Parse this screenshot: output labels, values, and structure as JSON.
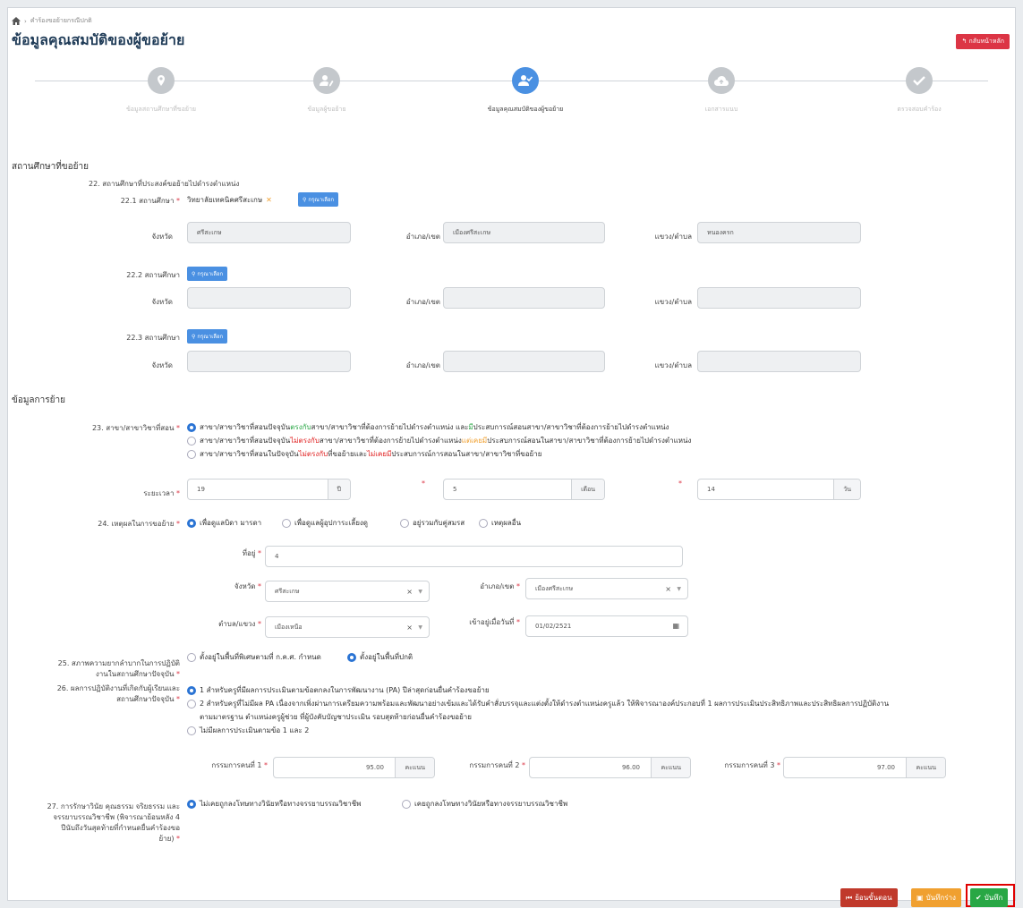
{
  "breadcrumb": {
    "home_icon": "home-icon",
    "path": "คำร้องขอย้ายกรณีปกติ"
  },
  "title": "ข้อมูลคุณสมบัติของผู้ขอย้าย",
  "back_button": "กลับหน้าหลัก",
  "steps": [
    {
      "label": "ข้อมูลสถานศึกษาที่ขอย้าย",
      "icon": "map-pin-icon",
      "active": false
    },
    {
      "label": "ข้อมูลผู้ขอย้าย",
      "icon": "user-edit-icon",
      "active": false
    },
    {
      "label": "ข้อมูลคุณสมบัติของผู้ขอย้าย",
      "icon": "user-check-icon",
      "active": true
    },
    {
      "label": "เอกสารแนบ",
      "icon": "cloud-upload-icon",
      "active": false
    },
    {
      "label": "ตรวจสอบคำร้อง",
      "icon": "check-icon",
      "active": false
    }
  ],
  "section_school": "สถานศึกษาที่ขอย้าย",
  "q22": {
    "heading": "22. สถานศึกษาที่ประสงค์ขอย้ายไปดำรงตำแหน่ง",
    "s1_label": "22.1 สถานศึกษา",
    "s1_value": "วิทยาลัยเทคนิคศรีสะเกษ",
    "s2_label": "22.2 สถานศึกษา",
    "s3_label": "22.3 สถานศึกษา",
    "select_button": "กรุณาเลือก",
    "province_label": "จังหวัด",
    "district_label": "อำเภอ/เขต",
    "subdistrict_label": "แขวง/ตำบล",
    "s1_province": "ศรีสะเกษ",
    "s1_district": "เมืองศรีสะเกษ",
    "s1_subdistrict": "หนองครก"
  },
  "section_transfer": "ข้อมูลการย้าย",
  "q23": {
    "label": "23. สาขา/สาขาวิชาที่สอน",
    "opt1": {
      "a": "สาขา/สาขาวิชาที่สอนปัจจุบัน",
      "b": "ตรงกับ",
      "c": " สาขา/สาขาวิชาที่ต้องการย้ายไปดำรงตำแหน่ง และ",
      "d": "มี",
      "e": "ประสบการณ์สอนสาขา/สาขาวิชาที่ต้องการย้ายไปดำรงตำแหน่ง"
    },
    "opt2": {
      "a": "สาขา/สาขาวิชาที่สอนปัจจุบัน",
      "b": "ไม่ตรงกับ",
      "c": " สาขา/สาขาวิชาที่ต้องการย้ายไปดำรงตำแหน่ง ",
      "d": "แต่เคยมี",
      "e": "ประสบการณ์สอนในสาขา/สาขาวิชาที่ต้องการย้ายไปดำรงตำแหน่ง"
    },
    "opt3": {
      "a": "สาขา/สาขาวิชาที่สอนในปัจจุบัน",
      "b": "ไม่ตรงกับ",
      "c": " ที่ขอย้ายและ",
      "d": "ไม่เคยมี",
      "e": "ประสบการณ์การสอนในสาขา/สาขาวิชาที่ขอย้าย"
    },
    "selected": 1
  },
  "duration": {
    "label": "ระยะเวลา",
    "years": "19",
    "years_unit": "ปี",
    "months": "5",
    "months_unit": "เดือน",
    "days": "14",
    "days_unit": "วัน"
  },
  "q24": {
    "label": "24. เหตุผลในการขอย้าย",
    "options": [
      "เพื่อดูแลบิดา มารดา",
      "เพื่อดูแลผู้อุปการะเลี้ยงดู",
      "อยู่รวมกับคู่สมรส",
      "เหตุผลอื่น"
    ],
    "selected": 0,
    "address_label": "ที่อยู่",
    "address_value": "4",
    "province_label": "จังหวัด",
    "province_value": "ศรีสะเกษ",
    "district_label": "อำเภอ/เขต",
    "district_value": "เมืองศรีสะเกษ",
    "subdistrict_label": "ตำบล/แขวง",
    "subdistrict_value": "เมืองเหนือ",
    "movein_label": "เข้าอยู่เมื่อวันที่",
    "movein_value": "01/02/2521"
  },
  "q25": {
    "label_line1": "25. สภาพความยากลำบากในการปฏิบัติ",
    "label_line2": "งานในสถานศึกษาปัจจุบัน",
    "options": [
      "ตั้งอยู่ในพื้นที่พิเศษตามที่ ก.ค.ศ. กำหนด",
      "ตั้งอยู่ในพื้นที่ปกติ"
    ],
    "selected": 1
  },
  "q26": {
    "label_line1": "26. ผลการปฏิบัติงานที่เกิดกับผู้เรียนและ",
    "label_line2": "สถานศึกษาปัจจุบัน",
    "opt1": "1 สำหรับครูที่มีผลการประเมินตามข้อตกลงในการพัฒนางาน (PA) ปีล่าสุดก่อนยื่นคำร้องขอย้าย",
    "opt2_line1": "2 สำหรับครูที่ไม่มีผล PA เนื่องจากเพิ่งผ่านการเตรียมความพร้อมและพัฒนาอย่างเข้มและได้รับคำสั่งบรรจุและแต่งตั้งให้ดำรงตำแหน่งครูแล้ว ให้พิจารณาองค์ประกอบที่ 1 ผลการประเมินประสิทธิภาพและประสิทธิผลการปฏิบัติงาน",
    "opt2_line2": "ตามมาตรฐาน ตำแหน่งครูผู้ช่วย ที่ผู้บังคับบัญชาประเมิน รอบสุดท้ายก่อนยื่นคำร้องขอย้าย",
    "opt3": "ไม่มีผลการประเมินตามข้อ 1 และ 2",
    "selected": 0,
    "judge1_label": "กรรมการคนที่ 1",
    "judge1_value": "95.00",
    "judge2_label": "กรรมการคนที่ 2",
    "judge2_value": "96.00",
    "judge3_label": "กรรมการคนที่ 3",
    "judge3_value": "97.00",
    "score_unit": "คะแนน"
  },
  "q27": {
    "label_lines": [
      "27. การรักษาวินัย คุณธรรม จริยธรรม และ",
      "จรรยาบรรณวิชาชีพ (พิจารณาย้อนหลัง 4",
      "ปีนับถึงวันสุดท้ายที่กำหนดยื่นคำร้องขอ",
      "ย้าย)"
    ],
    "options": [
      "ไม่เคยถูกลงโทษทางวินัยหรือทางจรรยาบรรณวิชาชีพ",
      "เคยถูกลงโทษทางวินัยหรือทางจรรยาบรรณวิชาชีพ"
    ],
    "selected": 0
  },
  "actions": {
    "back": "ย้อนขั้นตอน",
    "draft": "บันทึกร่าง",
    "save": "บันทึก"
  },
  "colors": {
    "primary": "#4a90e2",
    "danger": "#dc3545",
    "warning": "#f0a030",
    "success": "#28a745",
    "highlight": "#e00000"
  }
}
